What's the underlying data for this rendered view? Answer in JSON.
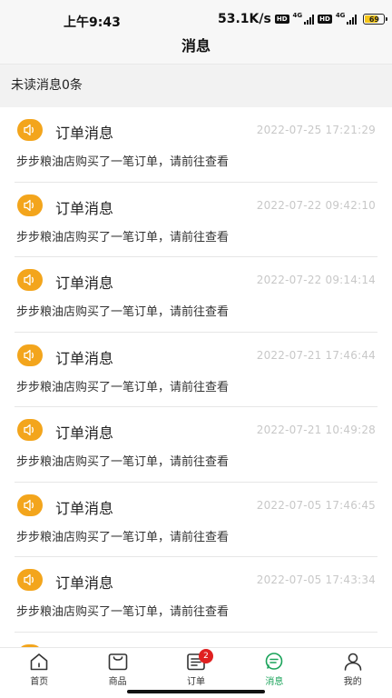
{
  "status_bar": {
    "time": "上午9:43",
    "network_speed": "53.1K/s",
    "hd1": "HD",
    "net1": "4G",
    "hd2": "HD",
    "net2": "4G",
    "battery": "69",
    "battery_level": 0.69
  },
  "header": {
    "title": "消息"
  },
  "unread": {
    "text": "未读消息0条"
  },
  "accent_color": "#f3a51c",
  "messages": [
    {
      "title": "订单消息",
      "time": "2022-07-25 17:21:29",
      "body": "步步粮油店购买了一笔订单，请前往查看"
    },
    {
      "title": "订单消息",
      "time": "2022-07-22 09:42:10",
      "body": "步步粮油店购买了一笔订单，请前往查看"
    },
    {
      "title": "订单消息",
      "time": "2022-07-22 09:14:14",
      "body": "步步粮油店购买了一笔订单，请前往查看"
    },
    {
      "title": "订单消息",
      "time": "2022-07-21 17:46:44",
      "body": "步步粮油店购买了一笔订单，请前往查看"
    },
    {
      "title": "订单消息",
      "time": "2022-07-21 10:49:28",
      "body": "步步粮油店购买了一笔订单，请前往查看"
    },
    {
      "title": "订单消息",
      "time": "2022-07-05 17:46:45",
      "body": "步步粮油店购买了一笔订单，请前往查看"
    },
    {
      "title": "订单消息",
      "time": "2022-07-05 17:43:34",
      "body": "步步粮油店购买了一笔订单，请前往查看"
    },
    {
      "title": "",
      "time": "",
      "body": ""
    }
  ],
  "tabs": [
    {
      "label": "首页",
      "icon": "home-icon",
      "active": false
    },
    {
      "label": "商品",
      "icon": "bag-icon",
      "active": false
    },
    {
      "label": "订单",
      "icon": "order-icon",
      "active": false,
      "badge": "2"
    },
    {
      "label": "消息",
      "icon": "message-icon",
      "active": true
    },
    {
      "label": "我的",
      "icon": "user-icon",
      "active": false
    }
  ],
  "active_color": "#1aa35a",
  "badge_color": "#e02020"
}
